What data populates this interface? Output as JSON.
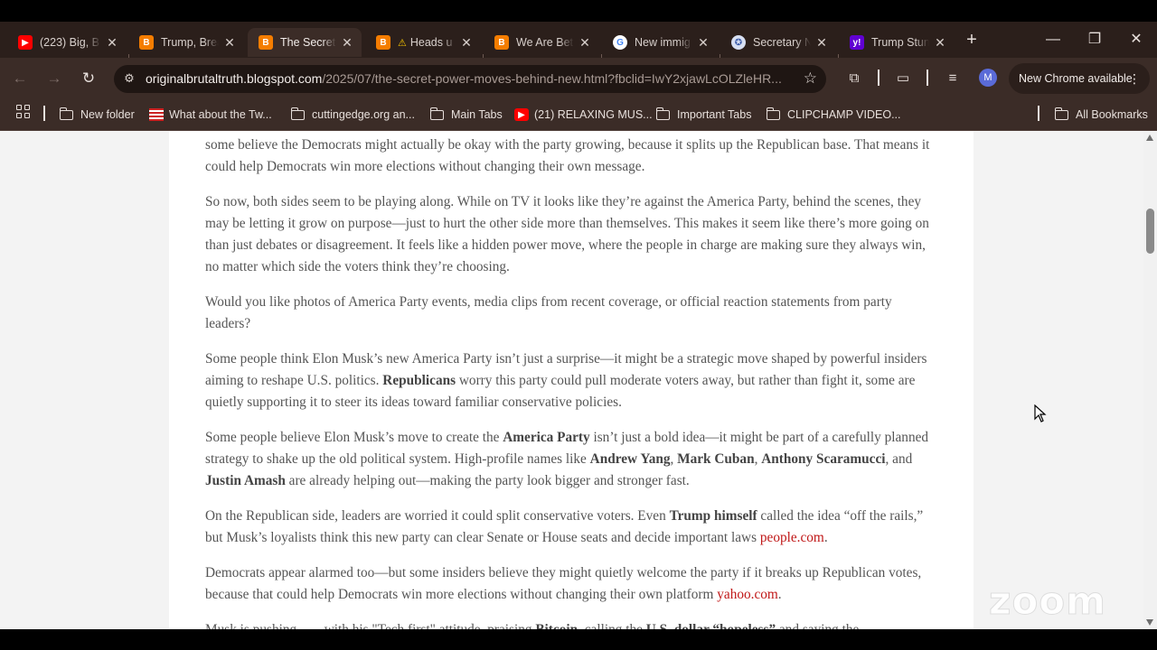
{
  "tabs": [
    {
      "title": "(223) Big, B",
      "icon": "youtube-icon",
      "color": "#ff0000"
    },
    {
      "title": "Trump, Brea",
      "icon": "blogger-icon",
      "color": "#f57d00"
    },
    {
      "title": "The Secret",
      "icon": "blogger-icon",
      "color": "#f57d00",
      "active": true
    },
    {
      "title": "Heads u",
      "icon": "blogger-icon",
      "color": "#f57d00"
    },
    {
      "title": "We Are Bet",
      "icon": "blogger-icon",
      "color": "#f57d00"
    },
    {
      "title": "New immig",
      "icon": "google-icon",
      "color": "#4285f4"
    },
    {
      "title": "Secretary N",
      "icon": "seal-icon",
      "color": "#3a5aa8"
    },
    {
      "title": "Trump Stun",
      "icon": "yahoo-icon",
      "color": "#6001d2"
    }
  ],
  "toolbar": {
    "url_host": "originalbrutaltruth.blogspot.com",
    "url_path": "/2025/07/the-secret-power-moves-behind-new.html?fbclid=IwY2xjawLcOLZleHR...",
    "profile_initial": "M",
    "update_label": "New Chrome available"
  },
  "bookmarks": [
    {
      "label": "New folder",
      "type": "folder"
    },
    {
      "label": "What about the Tw...",
      "type": "site"
    },
    {
      "label": "cuttingedge.org an...",
      "type": "folder"
    },
    {
      "label": "Main Tabs",
      "type": "folder"
    },
    {
      "label": "(21) RELAXING MUS...",
      "type": "youtube"
    },
    {
      "label": "Important Tabs",
      "type": "folder"
    },
    {
      "label": "CLIPCHAMP VIDEO...",
      "type": "folder"
    },
    {
      "label": "All Bookmarks",
      "type": "folder"
    }
  ],
  "article": {
    "p1": "some believe the Democrats might actually be okay with the party growing, because it splits up the Republican base. That means it could help Democrats win more elections without changing their own message.",
    "p2": "So now, both sides seem to be playing along. While on TV it looks like they’re against the America Party, behind the scenes, they may be letting it grow on purpose—just to hurt the other side more than themselves. This makes it seem like there’s more going on than just debates or disagreement. It feels like a hidden power move, where the people in charge are making sure they always win, no matter which side the voters think they’re choosing.",
    "p3": "Would you like photos of America Party events, media clips from recent coverage, or official reaction statements from party leaders?",
    "p4a": "Some people think Elon Musk’s new America Party isn’t just a surprise—it might be a strategic move shaped by powerful insiders aiming to reshape U.S. politics. ",
    "p4b": "Republicans",
    "p4c": " worry this party could pull moderate voters away, but rather than fight it, some are quietly supporting it to steer its ideas toward familiar conservative policies.",
    "p5a": "Some people believe Elon Musk’s move to create the ",
    "p5b": "America Party",
    "p5c": " isn’t just a bold idea—it might be part of a carefully planned strategy to shake up the old political system. High-profile names like ",
    "p5d": "Andrew Yang",
    "p5e": ", ",
    "p5f": "Mark Cuban",
    "p5g": ", ",
    "p5h": "Anthony Scaramucci",
    "p5i": ", and ",
    "p5j": "Justin Amash",
    "p5k": " are already helping out—making the party look bigger and stronger fast.",
    "p6a": "On the Republican side, leaders are worried it could split conservative voters. Even ",
    "p6b": "Trump himself",
    "p6c": " called the idea “off the rails,” but Musk’s loyalists think this new party can clear Senate or House seats and decide important laws ",
    "p6link": "people.com",
    "p6d": ".",
    "p7a": "Democrats appear alarmed too—but some insiders believe they might quietly welcome the party if it breaks up Republican votes, because that could help Democrats win more elections without changing their own platform ",
    "p7link": "yahoo.com",
    "p7d": ".",
    "p8a": "Musk is pushing ...... with his \"Tech first\" attitude, praising ",
    "p8b": "Bitcoin",
    "p8c": ", calling the ",
    "p8d": "U.S. dollar “hopeless”",
    "p8e": " and saying the"
  },
  "watermark": "zoom"
}
